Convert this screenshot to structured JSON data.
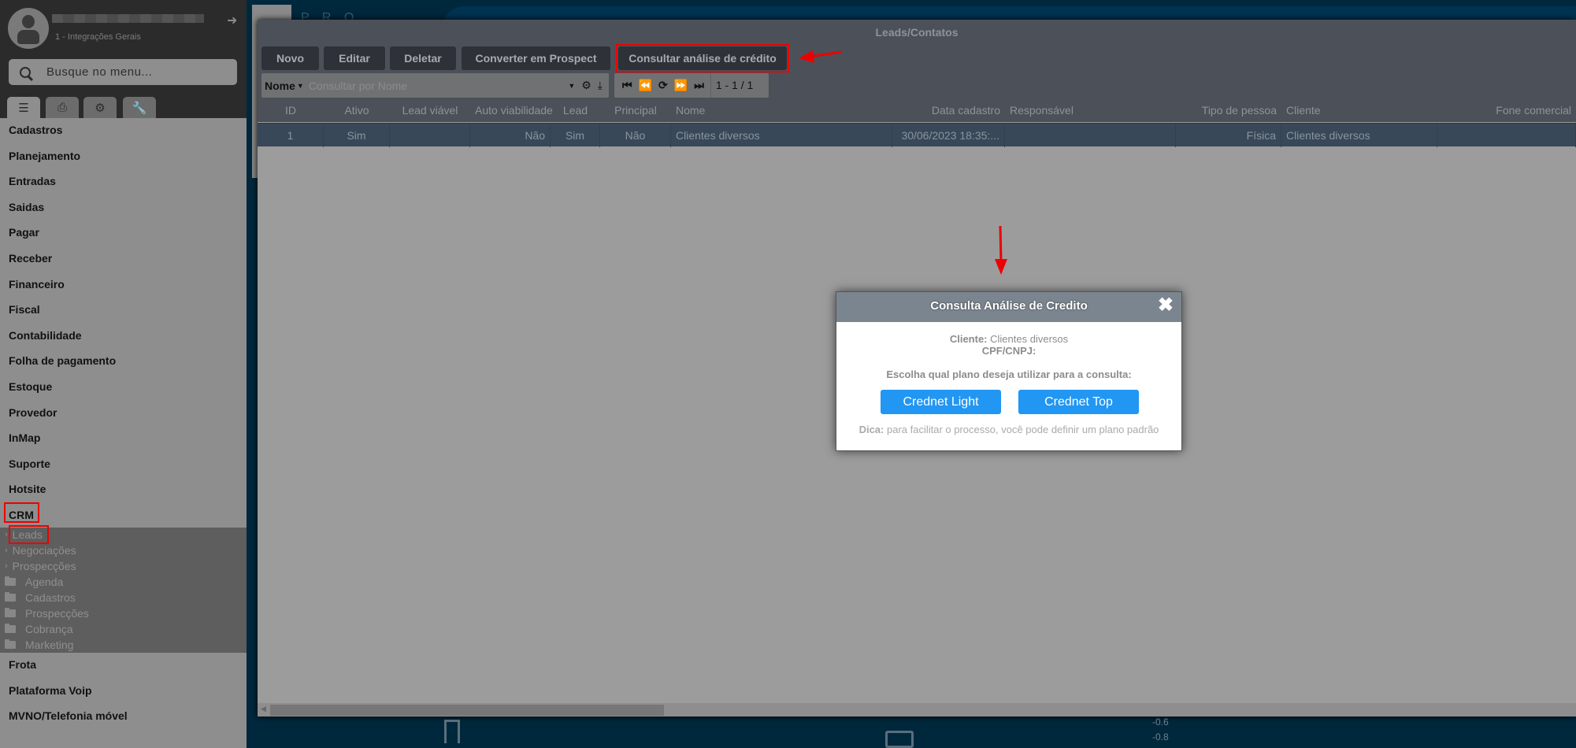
{
  "sidebar": {
    "company": "1 - Integrações Gerais",
    "search_placeholder": "Busque no menu...",
    "tabs": [
      "list-icon",
      "printer-icon",
      "gears-icon",
      "wrench-icon"
    ],
    "items": [
      "Cadastros",
      "Planejamento",
      "Entradas",
      "Saidas",
      "Pagar",
      "Receber",
      "Financeiro",
      "Fiscal",
      "Contabilidade",
      "Folha de pagamento",
      "Estoque",
      "Provedor",
      "InMap",
      "Suporte",
      "Hotsite",
      "CRM"
    ],
    "crm_sub": [
      "Leads",
      "Negociações",
      "Prospecções"
    ],
    "crm_folders": [
      "Agenda",
      "Cadastros",
      "Prospecções",
      "Cobrança",
      "Marketing"
    ],
    "items_after": [
      "Frota",
      "Plataforma Voip",
      "MVNO/Telefonia móvel"
    ]
  },
  "background": {
    "brand": "P R O",
    "axis": [
      "-0.6",
      "-0.8"
    ]
  },
  "window": {
    "title": "Leads/Contatos",
    "toolbar": [
      "Novo",
      "Editar",
      "Deletar",
      "Converter em Prospect",
      "Consultar análise de crédito"
    ],
    "search_field": "Nome",
    "search_placeholder": "Consultar por Nome",
    "pagination": "1 - 1 / 1",
    "columns": [
      "ID",
      "Ativo",
      "Lead viável",
      "Auto viabilidade",
      "Lead",
      "Principal",
      "Nome",
      "Data cadastro",
      "Responsável",
      "Tipo de pessoa",
      "Cliente",
      "Fone comercial"
    ],
    "rows": [
      [
        "1",
        "Sim",
        "",
        "Não",
        "Sim",
        "Não",
        "Clientes diversos",
        "30/06/2023 18:35:...",
        "",
        "Física",
        "Clientes diversos",
        ""
      ]
    ]
  },
  "modal": {
    "title": "Consulta Análise de Credito",
    "cliente_label": "Cliente:",
    "cliente_value": "Clientes diversos",
    "cpf_label": "CPF/CNPJ:",
    "prompt": "Escolha qual plano deseja utilizar para a consulta:",
    "buttons": [
      "Crednet Light",
      "Crednet Top"
    ],
    "tip_label": "Dica:",
    "tip": "para facilitar o processo, você pode definir um plano padrão"
  },
  "colors": {
    "accent": "#2196f3",
    "highlight": "#e00000"
  }
}
